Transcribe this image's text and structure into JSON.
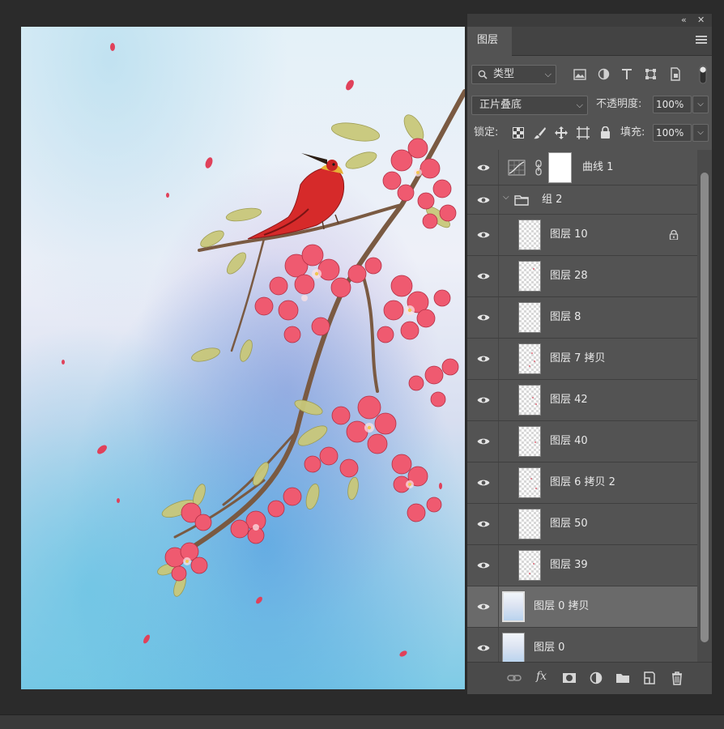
{
  "panel": {
    "tab_label": "图层",
    "filter": {
      "label": "类型"
    },
    "blend_mode": "正片叠底",
    "opacity_label": "不透明度:",
    "opacity_value": "100%",
    "lock_label": "锁定:",
    "fill_label": "填充:",
    "fill_value": "100%"
  },
  "layers": [
    {
      "name": "曲线 1",
      "type": "adjustment",
      "visible": true
    },
    {
      "name": "组 2",
      "type": "group",
      "visible": true,
      "expanded": true
    },
    {
      "name": "图层 10",
      "type": "layer",
      "visible": true,
      "locked": true
    },
    {
      "name": "图层 28",
      "type": "layer",
      "visible": true
    },
    {
      "name": "图层 8",
      "type": "layer",
      "visible": true
    },
    {
      "name": "图层 7 拷贝",
      "type": "layer",
      "visible": true
    },
    {
      "name": "图层 42",
      "type": "layer",
      "visible": true
    },
    {
      "name": "图层 40",
      "type": "layer",
      "visible": true
    },
    {
      "name": "图层 6 拷贝 2",
      "type": "layer",
      "visible": true
    },
    {
      "name": "图层 50",
      "type": "layer",
      "visible": true
    },
    {
      "name": "图层 39",
      "type": "layer",
      "visible": true
    },
    {
      "name": "图层 0 拷贝",
      "type": "image",
      "visible": true,
      "selected": true
    },
    {
      "name": "图层 0",
      "type": "image",
      "visible": true
    }
  ],
  "colors": {
    "panel_bg": "#535353",
    "selected_row": "#6a6a6a",
    "petal": "#e8415a",
    "bird": "#d62a2a",
    "sky_blue": "#7cc6e8"
  }
}
